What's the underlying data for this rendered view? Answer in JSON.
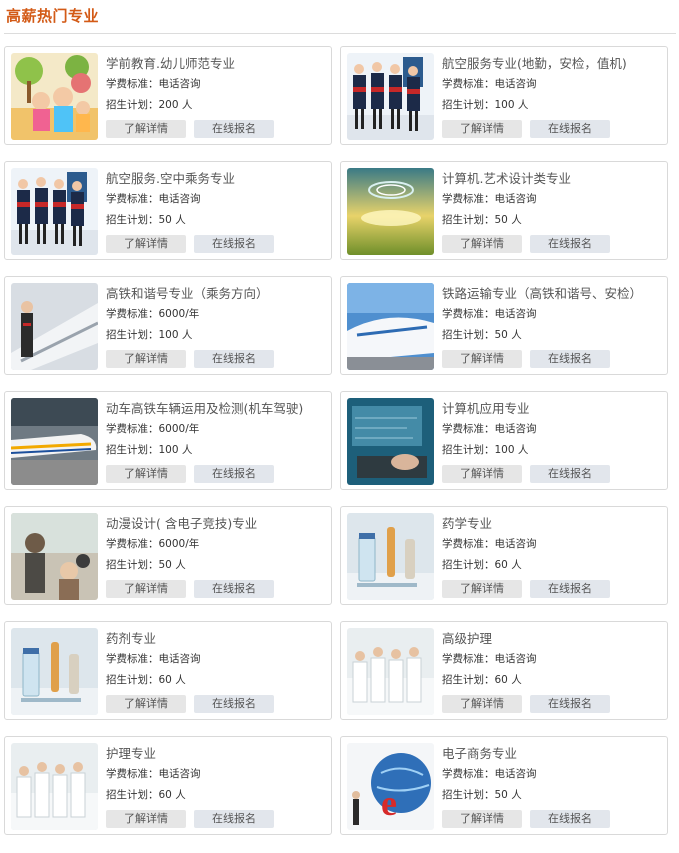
{
  "section": {
    "title": "高薪热门专业"
  },
  "fee_label": "学费标准：",
  "plan_label": "招生计划：",
  "buttons": {
    "details": "了解详情",
    "signup": "在线报名"
  },
  "colors": {
    "title": "#d35a16",
    "button_bg": "#e6e6e6",
    "border": "#d9d9d9"
  },
  "majors": [
    {
      "name": "学前教育.幼儿师范专业",
      "fee": "电话咨询",
      "plan": "200 人",
      "image": "children-teacher-photo"
    },
    {
      "name": "航空服务专业(地勤，安检，值机)",
      "fee": "电话咨询",
      "plan": "100 人",
      "image": "flight-attendants-photo"
    },
    {
      "name": "航空服务.空中乘务专业",
      "fee": "电话咨询",
      "plan": "50 人",
      "image": "flight-attendants-photo"
    },
    {
      "name": "计算机.艺术设计类专业",
      "fee": "电话咨询",
      "plan": "50 人",
      "image": "abstract-sunrise-photo"
    },
    {
      "name": "高铁和谐号专业（乘务方向）",
      "fee": "6000/年",
      "plan": "100 人",
      "image": "train-attendant-photo"
    },
    {
      "name": "铁路运输专业（高铁和谐号、安检）",
      "fee": "电话咨询",
      "plan": "50 人",
      "image": "bullet-train-photo"
    },
    {
      "name": "动车高铁车辆运用及检测(机车驾驶)",
      "fee": "6000/年",
      "plan": "100 人",
      "image": "high-speed-train-photo"
    },
    {
      "name": "计算机应用专业",
      "fee": "电话咨询",
      "plan": "100 人",
      "image": "keyboard-hands-photo"
    },
    {
      "name": "动漫设计( 含电子竞技)专业",
      "fee": "6000/年",
      "plan": "50 人",
      "image": "anime-characters-photo"
    },
    {
      "name": "药学专业",
      "fee": "电话咨询",
      "plan": "60 人",
      "image": "medicine-vials-photo"
    },
    {
      "name": "药剂专业",
      "fee": "电话咨询",
      "plan": "60 人",
      "image": "medicine-vials-photo"
    },
    {
      "name": "高级护理",
      "fee": "电话咨询",
      "plan": "60 人",
      "image": "nurses-photo"
    },
    {
      "name": "护理专业",
      "fee": "电话咨询",
      "plan": "60 人",
      "image": "nurses-photo"
    },
    {
      "name": "电子商务专业",
      "fee": "电话咨询",
      "plan": "50 人",
      "image": "ecommerce-globe-photo"
    }
  ]
}
